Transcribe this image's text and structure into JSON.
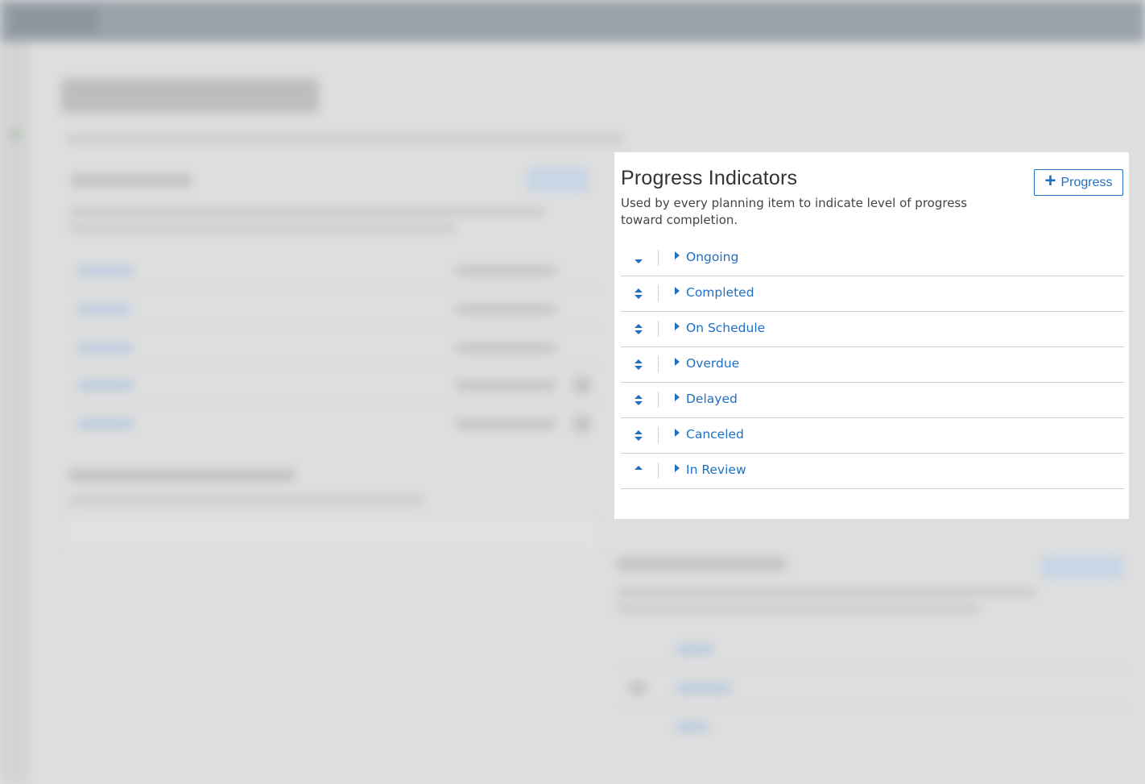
{
  "panel": {
    "title": "Progress Indicators",
    "description": "Used by every planning item to indicate level of progress toward completion.",
    "add_button_label": "Progress",
    "add_button_icon": "plus-icon"
  },
  "indicators": [
    {
      "label": "Ongoing",
      "sort_icon": "sort-down-icon"
    },
    {
      "label": "Completed",
      "sort_icon": "sort-icon"
    },
    {
      "label": "On Schedule",
      "sort_icon": "sort-icon"
    },
    {
      "label": "Overdue",
      "sort_icon": "sort-icon"
    },
    {
      "label": "Delayed",
      "sort_icon": "sort-icon"
    },
    {
      "label": "Canceled",
      "sort_icon": "sort-icon"
    },
    {
      "label": "In Review",
      "sort_icon": "sort-up-icon"
    }
  ],
  "colors": {
    "accent": "#1f6fc4",
    "text": "#333333",
    "overlay_background": "#dedede"
  }
}
